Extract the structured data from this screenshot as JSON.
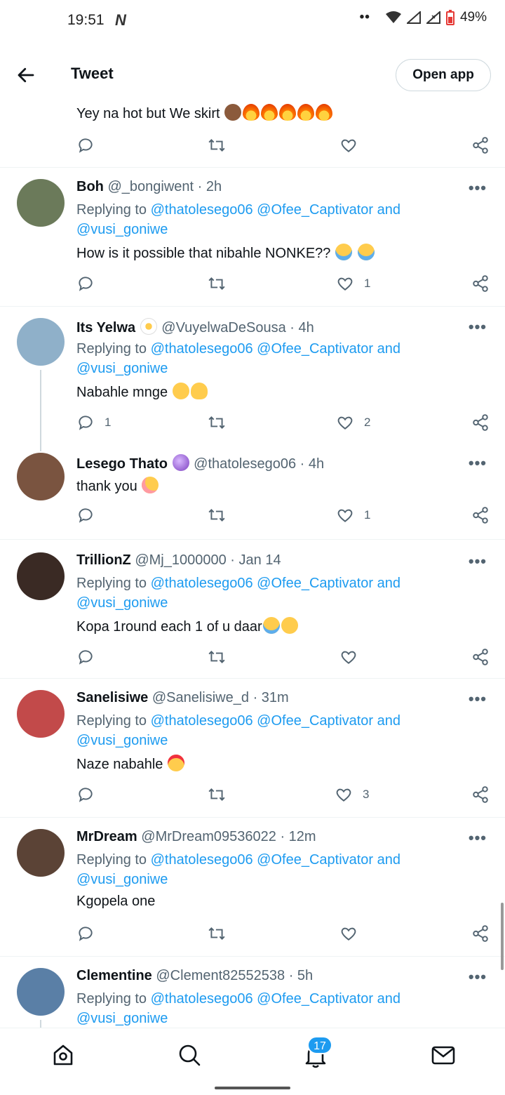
{
  "status": {
    "time": "19:51",
    "app_glyph": "N",
    "battery": "49%"
  },
  "header": {
    "title": "Tweet",
    "open_app": "Open app"
  },
  "top_tweet": {
    "text": "Yey na hot but We skirt"
  },
  "replies_prefix": "Replying to",
  "mentions": [
    "@thatolesego06",
    "@Ofee_Captivator",
    "and",
    "@vusi_goniwe"
  ],
  "tweets": [
    {
      "name": "Boh",
      "handle": "@_bongiwent",
      "time": "· 2h",
      "reply": true,
      "body": "How is it possible that nibahle NONKE??",
      "replies": "",
      "likes": "1",
      "avatar": "#6b7a5a"
    },
    {
      "name": "Its Yelwa",
      "handle": "@VuyelwaDeSousa",
      "time": "· 4h",
      "reply": true,
      "body": "Nabahle mnge",
      "replies": "1",
      "likes": "2",
      "avatar": "#8fb0c9"
    },
    {
      "name": "Lesego Thato",
      "handle": "@thatolesego06",
      "time": "· 4h",
      "reply": false,
      "body": "thank you",
      "replies": "",
      "likes": "1",
      "avatar": "#7a5440"
    },
    {
      "name": "TrillionZ",
      "handle": "@Mj_1000000",
      "time": "· Jan 14",
      "reply": true,
      "body": "Kopa 1round each 1 of u daar",
      "replies": "",
      "likes": "",
      "avatar": "#3a2a24"
    },
    {
      "name": "Sanelisiwe",
      "handle": "@Sanelisiwe_d",
      "time": "· 31m",
      "reply": true,
      "body": "Naze nabahle",
      "replies": "",
      "likes": "3",
      "avatar": "#c24a4a"
    },
    {
      "name": "MrDream",
      "handle": "@MrDream09536022",
      "time": "· 12m",
      "reply": true,
      "body": "Kgopela one",
      "replies": "",
      "likes": "",
      "avatar": "#5b4336"
    },
    {
      "name": "Clementine",
      "handle": "@Clement82552538",
      "time": "· 5h",
      "reply": true,
      "body": "",
      "replies": "",
      "likes": "",
      "avatar": "#5a7fa6"
    }
  ],
  "more_glyph": "•••",
  "nav": {
    "notifications_badge": "17"
  },
  "colors": {
    "link": "#1d9bf0",
    "secondary": "#536471",
    "badge": "#1d9bf0"
  }
}
